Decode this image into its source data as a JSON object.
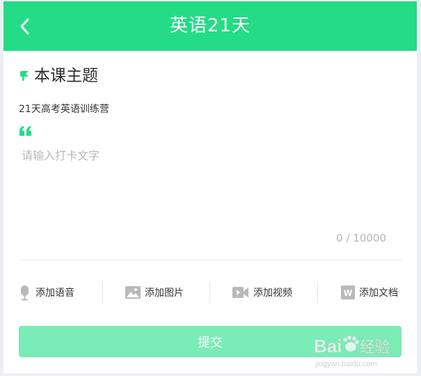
{
  "colors": {
    "brand": "#24dc86",
    "submit_bg": "#7aecb6",
    "divider": "#ececec",
    "placeholder": "#b8b8b8",
    "icon_gray": "#b9b9b9"
  },
  "header": {
    "title": "英语21天",
    "back_icon": "chevron-left-icon"
  },
  "topic": {
    "icon": "pin-flag-icon",
    "heading": "本课主题",
    "course_name": "21天高考英语训练营"
  },
  "editor": {
    "quote_icon": "quote-icon",
    "placeholder": "请输入打卡文字",
    "value": "",
    "char_count": "0 / 10000"
  },
  "toolbar": {
    "items": [
      {
        "label": "添加语音",
        "icon": "microphone-icon"
      },
      {
        "label": "添加图片",
        "icon": "image-icon"
      },
      {
        "label": "添加视频",
        "icon": "video-icon"
      },
      {
        "label": "添加文档",
        "icon": "word-document-icon"
      }
    ]
  },
  "submit": {
    "label": "提交"
  },
  "watermark": {
    "brand": "Bai",
    "cn": "经验",
    "url": "jingyan.baidu.com"
  }
}
